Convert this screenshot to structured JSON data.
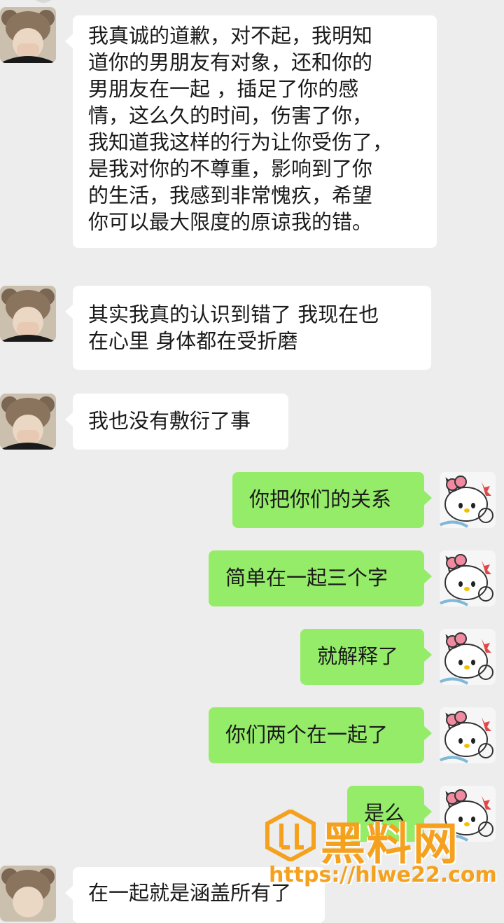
{
  "messages": [
    {
      "side": "in",
      "lines": [
        "我真诚的道歉，对不起，我明知",
        "道你的男朋友有对象，还和你的",
        "男朋友在一起 ，插足了你的感",
        "情，这么久的时间，伤害了你，",
        "我知道我这样的行为让你受伤了，",
        "是我对你的不尊重，影响到了你",
        "的生活，我感到非常愧疚，希望",
        "你可以最大限度的原谅我的错。"
      ]
    },
    {
      "side": "in",
      "lines": [
        "其实我真的认识到错了 我现在也",
        "在心里 身体都在受折磨"
      ]
    },
    {
      "side": "in",
      "lines": [
        "我也没有敷衍了事"
      ]
    },
    {
      "side": "out",
      "lines": [
        "你把你们的关系"
      ]
    },
    {
      "side": "out",
      "lines": [
        "简单在一起三个字"
      ]
    },
    {
      "side": "out",
      "lines": [
        "就解释了"
      ]
    },
    {
      "side": "out",
      "lines": [
        "你们两个在一起了"
      ]
    },
    {
      "side": "out",
      "lines": [
        "是么"
      ]
    },
    {
      "side": "in",
      "lines": [
        "在一起就是涵盖所有了"
      ]
    }
  ],
  "watermark": {
    "brand": "黑料网",
    "url": "https://hlwe22.com"
  },
  "colors": {
    "background": "#ededed",
    "incoming_bubble": "#ffffff",
    "outgoing_bubble": "#95ec69",
    "watermark": "#f5a11d"
  },
  "avatars": {
    "contact": "girl-with-bear-hat-avatar",
    "self": "hello-kitty-avatar"
  }
}
